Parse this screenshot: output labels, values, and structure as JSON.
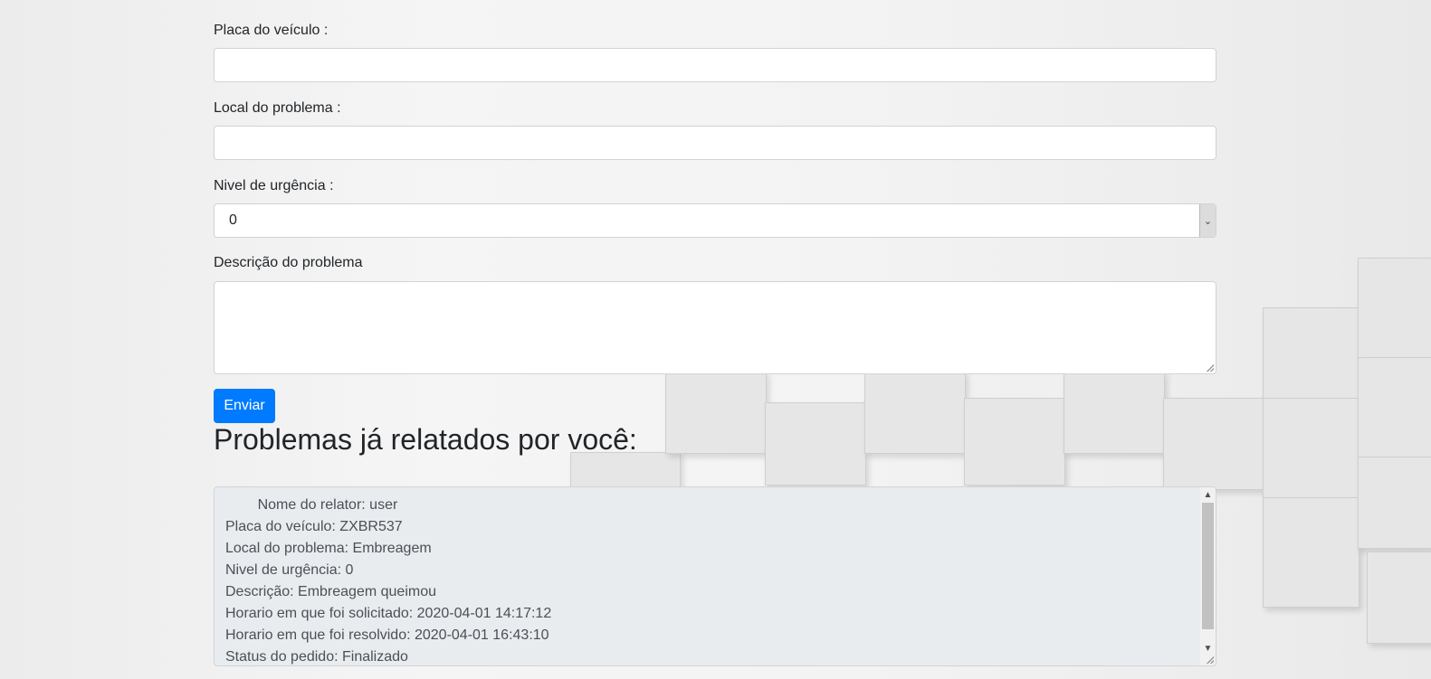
{
  "form": {
    "placa_label": "Placa do veículo :",
    "placa_value": "",
    "local_label": "Local do problema :",
    "local_value": "",
    "urgencia_label": "Nivel de urgência :",
    "urgencia_selected": "0",
    "descricao_label": "Descrição do problema",
    "descricao_value": "",
    "submit_label": "Enviar"
  },
  "reports": {
    "heading": "Problemas já relatados por você:",
    "lines": [
      "        Nome do relator: user",
      "Placa do veículo: ZXBR537",
      "Local do problema: Embreagem",
      "Nivel de urgência: 0",
      "Descrição: Embreagem queimou",
      "Horario em que foi solicitado: 2020-04-01 14:17:12",
      "Horario em que foi resolvido: 2020-04-01 16:43:10",
      "Status do pedido: Finalizado"
    ]
  },
  "colors": {
    "primary": "#007bff",
    "readonly_bg": "#e9ecef"
  }
}
